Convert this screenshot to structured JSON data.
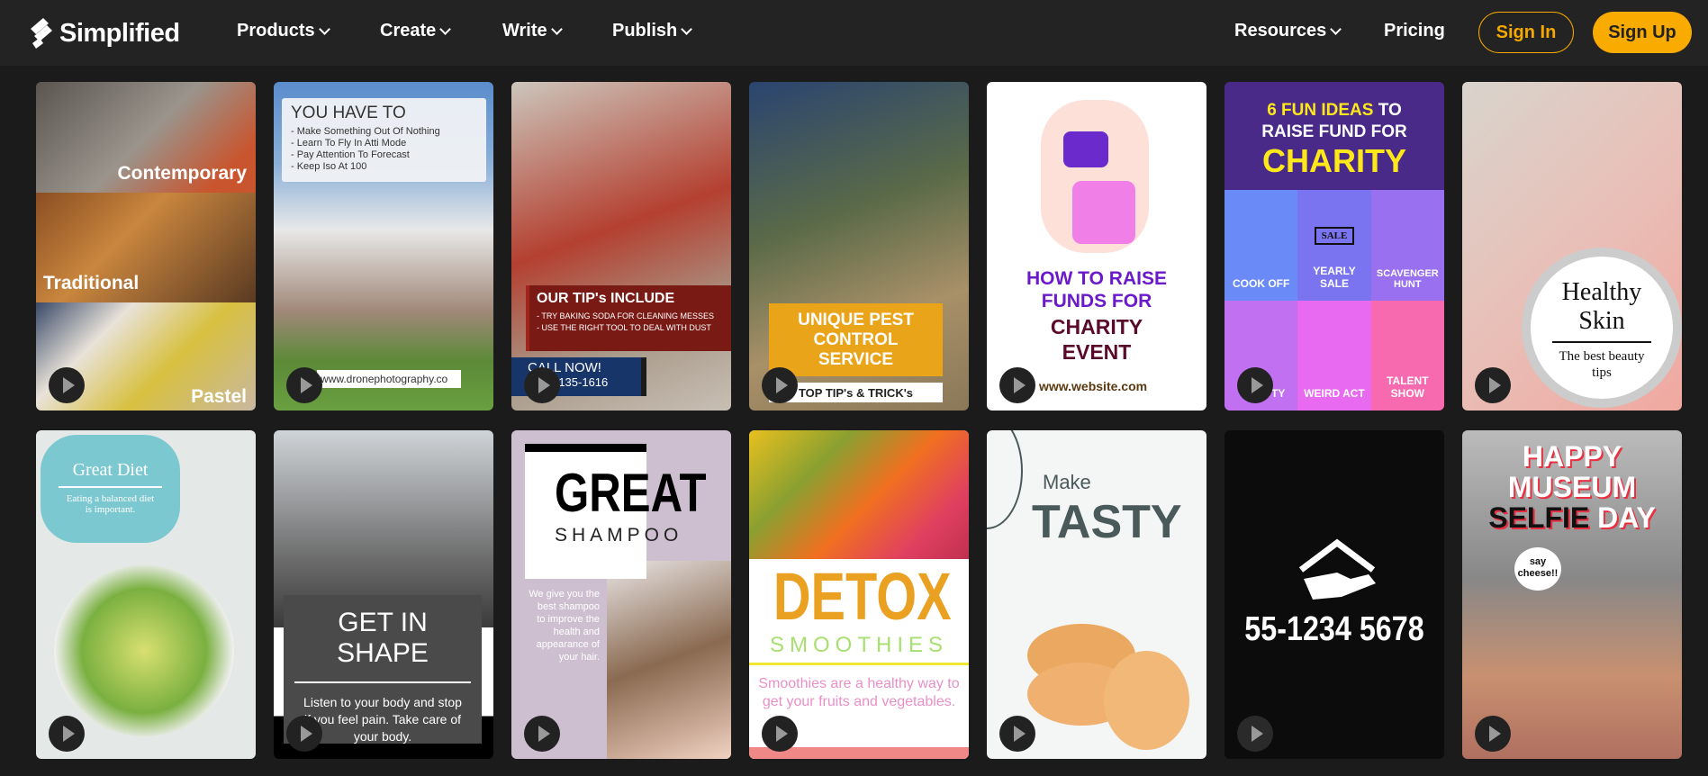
{
  "nav": {
    "brand": "Simplified",
    "items": [
      "Products",
      "Create",
      "Write",
      "Publish"
    ],
    "resources": "Resources",
    "pricing": "Pricing",
    "sign_in": "Sign In",
    "sign_up": "Sign Up"
  },
  "colors": {
    "accent": "#f9ab00",
    "nav_bg": "#232323",
    "page_bg": "#1b1b1b"
  },
  "cards": {
    "interiors": {
      "labels": [
        "Contemporary",
        "Traditional",
        "Pastel"
      ]
    },
    "drone": {
      "title": "YOU HAVE TO",
      "bullets": [
        "- Make Something Out Of Nothing",
        "- Learn To Fly In Atti Mode",
        "- Pay Attention To Forecast",
        "- Keep Iso At 100"
      ],
      "url": "www.dronephotography.co"
    },
    "cleaning": {
      "title": "OUR TIP's INCLUDE",
      "bullets": [
        "- TRY BAKING SODA FOR CLEANING MESSES",
        "- USE THE RIGHT TOOL TO DEAL WITH DUST"
      ],
      "call": "CALL NOW!",
      "phone": "-135-1616"
    },
    "pest": {
      "title": "UNIQUE PEST CONTROL SERVICE",
      "strip": "TOP TIP's & TRICK's"
    },
    "charity_event": {
      "lines": [
        "HOW TO RAISE",
        "FUNDS FOR"
      ],
      "lines2": [
        "CHARITY",
        "EVENT"
      ],
      "url": "www.website.com"
    },
    "fun_ideas": {
      "line1a": "6 FUN IDEAS",
      "line1b": "TO",
      "line2": "RAISE FUND FOR",
      "big": "CHARITY",
      "cells": [
        "COOK OFF",
        "YEARLY SALE",
        "SCAVENGER HUNT",
        "SE TY",
        "WEIRD ACT",
        "TALENT SHOW"
      ],
      "sign": "SALE"
    },
    "skin": {
      "title": "Healthy Skin",
      "sub": "The best beauty tips"
    },
    "diet": {
      "title": "Great Diet",
      "sub": "Eating a balanced diet is important."
    },
    "shape": {
      "title": "GET IN SHAPE",
      "body": "Listen to your body and stop if you feel pain. Take care of your body."
    },
    "shampoo": {
      "title": "GREAT",
      "sub": "SHAMPOO",
      "body": "We give you the best shampoo to improve the health and appearance of your hair."
    },
    "detox": {
      "title": "DETOX",
      "sub": "SMOOTHIES",
      "body": "Smoothies are a healthy way to get your fruits and vegetables."
    },
    "tasty": {
      "small": "Make",
      "big": "TASTY"
    },
    "phone": {
      "number": "55-1234 5678"
    },
    "museum": {
      "lines": [
        "HAPPY",
        "MUSEUM"
      ],
      "selfie": "SELFIE",
      "day": "DAY",
      "bubble": "say cheese!!"
    }
  }
}
